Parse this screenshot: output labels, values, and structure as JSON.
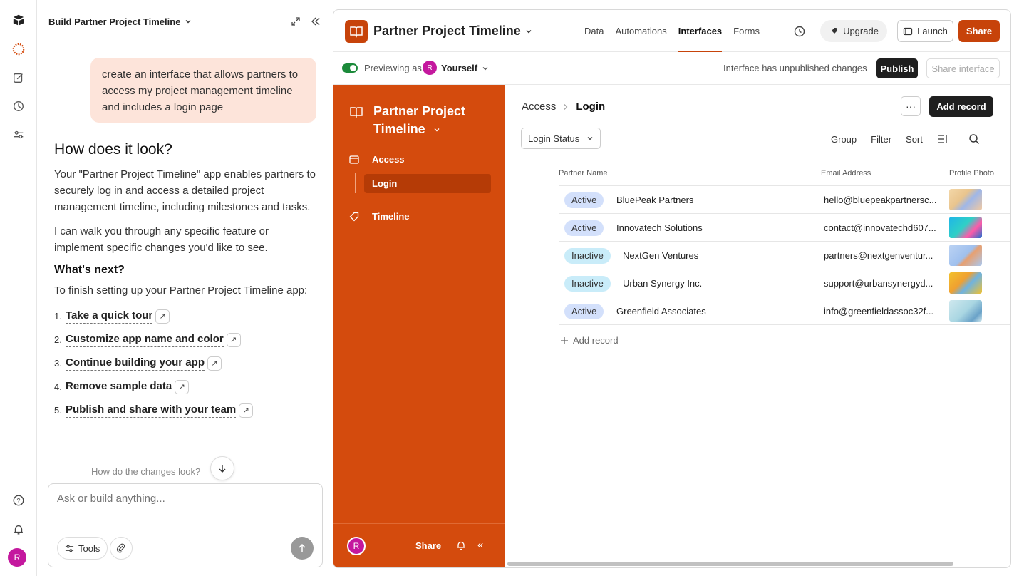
{
  "chat": {
    "title": "Build Partner Project Timeline",
    "user_message": "create an interface that allows partners to access my project management timeline and includes a login page",
    "answer_heading": "How does it look?",
    "answer_p1": "Your \"Partner Project Timeline\" app enables partners to securely log in and access a detailed project management timeline, including milestones and tasks.",
    "answer_p2": "I can walk you through any specific feature or implement specific changes you'd like to see.",
    "next_heading": "What's next?",
    "next_intro": "To finish setting up your Partner Project Timeline app:",
    "steps": [
      {
        "num": "1.",
        "label": "Take a quick tour"
      },
      {
        "num": "2.",
        "label": "Customize app name and color"
      },
      {
        "num": "3.",
        "label": "Continue building your app"
      },
      {
        "num": "4.",
        "label": "Remove sample data"
      },
      {
        "num": "5.",
        "label": "Publish and share with your team"
      }
    ],
    "changes_question": "How do the changes look?",
    "composer_placeholder": "Ask or build anything...",
    "tools_label": "Tools"
  },
  "rail": {
    "avatar_initial": "R"
  },
  "app": {
    "title": "Partner Project Timeline",
    "tabs": [
      "Data",
      "Automations",
      "Interfaces",
      "Forms"
    ],
    "active_tab": "Interfaces",
    "upgrade_label": "Upgrade",
    "launch_label": "Launch",
    "share_label": "Share",
    "accent_color": "#c7430a"
  },
  "preview": {
    "label": "Previewing as",
    "user_initial": "R",
    "user": "Yourself",
    "status": "Interface has unpublished changes",
    "publish_label": "Publish",
    "share_interface_label": "Share interface"
  },
  "sidebar": {
    "title": "Partner Project Timeline",
    "items": [
      {
        "label": "Access"
      },
      {
        "label": "Login"
      },
      {
        "label": "Timeline"
      }
    ],
    "footer_avatar": "R",
    "footer_share": "Share"
  },
  "main": {
    "breadcrumb": [
      "Access",
      "Login"
    ],
    "add_record_label": "Add record",
    "filter_label": "Login Status",
    "toolbar": [
      "Group",
      "Filter",
      "Sort"
    ],
    "columns": [
      "Partner Name",
      "Email Address",
      "Profile Photo"
    ],
    "rows": [
      {
        "status": "Active",
        "name": "BluePeak Partners",
        "email": "hello@bluepeakpartnersc..."
      },
      {
        "status": "Active",
        "name": "Innovatech Solutions",
        "email": "contact@innovatechd607..."
      },
      {
        "status": "Inactive",
        "name": "NextGen Ventures",
        "email": "partners@nextgenventur..."
      },
      {
        "status": "Inactive",
        "name": "Urban Synergy Inc.",
        "email": "support@urbansynergyd..."
      },
      {
        "status": "Active",
        "name": "Greenfield Associates",
        "email": "info@greenfieldassoc32f..."
      }
    ],
    "add_record_row": "Add record",
    "badge_colors": {
      "Active": "#d3e0fb",
      "Inactive": "#c9ecf9"
    }
  }
}
